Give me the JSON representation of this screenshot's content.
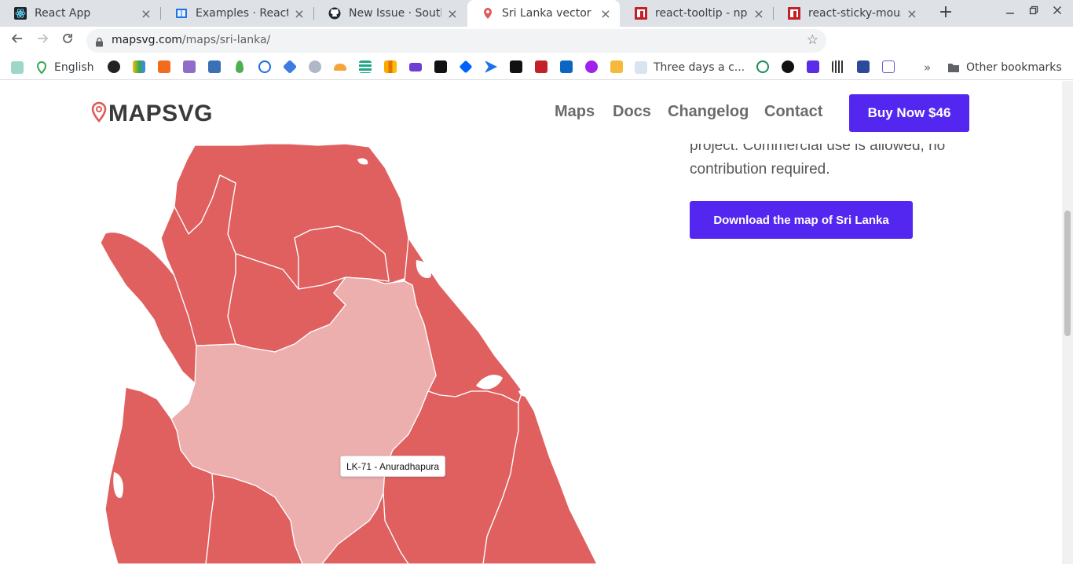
{
  "browser": {
    "tabs": [
      {
        "title": "React App",
        "icon": "react-icon",
        "active": false
      },
      {
        "title": "Examples · React Ve",
        "icon": "book-icon",
        "active": false
      },
      {
        "title": "New Issue · South-P",
        "icon": "github-icon",
        "active": false
      },
      {
        "title": "Sri Lanka vector ma",
        "icon": "map-pin-icon",
        "active": true
      },
      {
        "title": "react-tooltip - npm",
        "icon": "npm-icon",
        "active": false
      },
      {
        "title": "react-sticky-mouse-",
        "icon": "npm-icon",
        "active": false
      }
    ],
    "close_glyph": "×",
    "new_tab_glyph": "+",
    "url_host": "mapsvg.com",
    "url_path": "/maps/sri-lanka/",
    "bookmarks": {
      "english": "English",
      "three_days": "Three days a c...",
      "other": "Other bookmarks",
      "overflow": "»"
    }
  },
  "site": {
    "logo": "MAPSVG",
    "nav": {
      "maps": "Maps",
      "docs": "Docs",
      "changelog": "Changelog",
      "contact": "Contact"
    },
    "buy_button": "Buy Now $46",
    "desc_line1": "project. Commercial use is allowed, no",
    "desc_line2": "contribution required.",
    "download_button": "Download the map of Sri Lanka",
    "tooltip": "LK-71 - Anuradhapura"
  },
  "colors": {
    "accent": "#5327f0",
    "region": "#e06060",
    "region_hover": "#edaeae",
    "logo_pin": "#e05a5a"
  }
}
